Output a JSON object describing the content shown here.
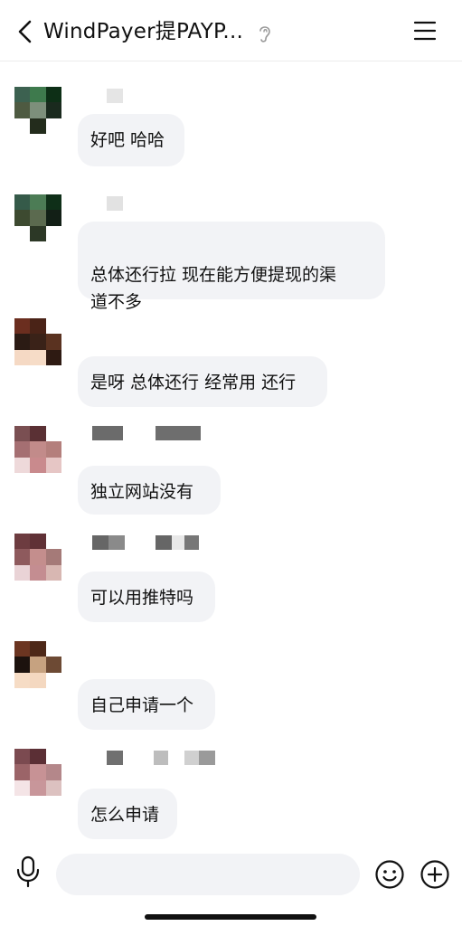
{
  "header": {
    "title": "WindPayer提PAYP..."
  },
  "messages": [
    {
      "text": "好吧 哈哈",
      "avatar": [
        "#3c6150",
        "#3e7a4d",
        "#0d2f16",
        "#4e5a41",
        "#7d8f7b",
        "#1a2a1e",
        "#ffffff",
        "#232c1c",
        "#ffffff"
      ]
    },
    {
      "text": "总体还行拉 现在能方便提现的渠\n道不多",
      "avatar": [
        "#355a49",
        "#4c7c55",
        "#0f2f18",
        "#3d4a30",
        "#5b6a4f",
        "#121f16",
        "#ffffff",
        "#2c3826",
        "#ffffff"
      ]
    },
    {
      "text": "是呀 总体还行 经常用 还行",
      "avatar": [
        "#6b2e1f",
        "#4a2317",
        "#ffffff",
        "#2b1b14",
        "#3a2218",
        "#5a3220",
        "#f5d9c4",
        "#f6dcc7",
        "#2e1a12"
      ]
    },
    {
      "text": "独立网站没有",
      "avatar": [
        "#7a4f52",
        "#5a3034",
        "#ffffff",
        "#a56f72",
        "#c28b8a",
        "#b47f7c",
        "#eed9da",
        "#c98a8d",
        "#e6c6c5"
      ]
    },
    {
      "text": "可以用推特吗",
      "avatar": [
        "#6d3c40",
        "#603136",
        "#ffffff",
        "#8e5a5d",
        "#c48e8d",
        "#a57a78",
        "#e9d3d6",
        "#c48d91",
        "#d8b7b2"
      ]
    },
    {
      "text": "自己申请一个",
      "avatar": [
        "#6b3521",
        "#4d2818",
        "#ffffff",
        "#1c120e",
        "#c6a280",
        "#6d4a34",
        "#f6dcc5",
        "#f4d8c0",
        "#ffffff"
      ]
    },
    {
      "text": "怎么申请",
      "avatar": [
        "#7b4a50",
        "#5b2f35",
        "#ffffff",
        "#9b6468",
        "#c79295",
        "#b4878a",
        "#f4e4e6",
        "#c8969a",
        "#dcc1c0"
      ]
    }
  ],
  "colors": {
    "bubble": "#f2f3f6",
    "header_text": "#111111"
  },
  "icons": {
    "back": "chevron-left-icon",
    "ear": "ear-icon",
    "menu": "hamburger-menu-icon",
    "mic": "microphone-icon",
    "emoji": "smile-icon",
    "plus": "plus-icon"
  }
}
